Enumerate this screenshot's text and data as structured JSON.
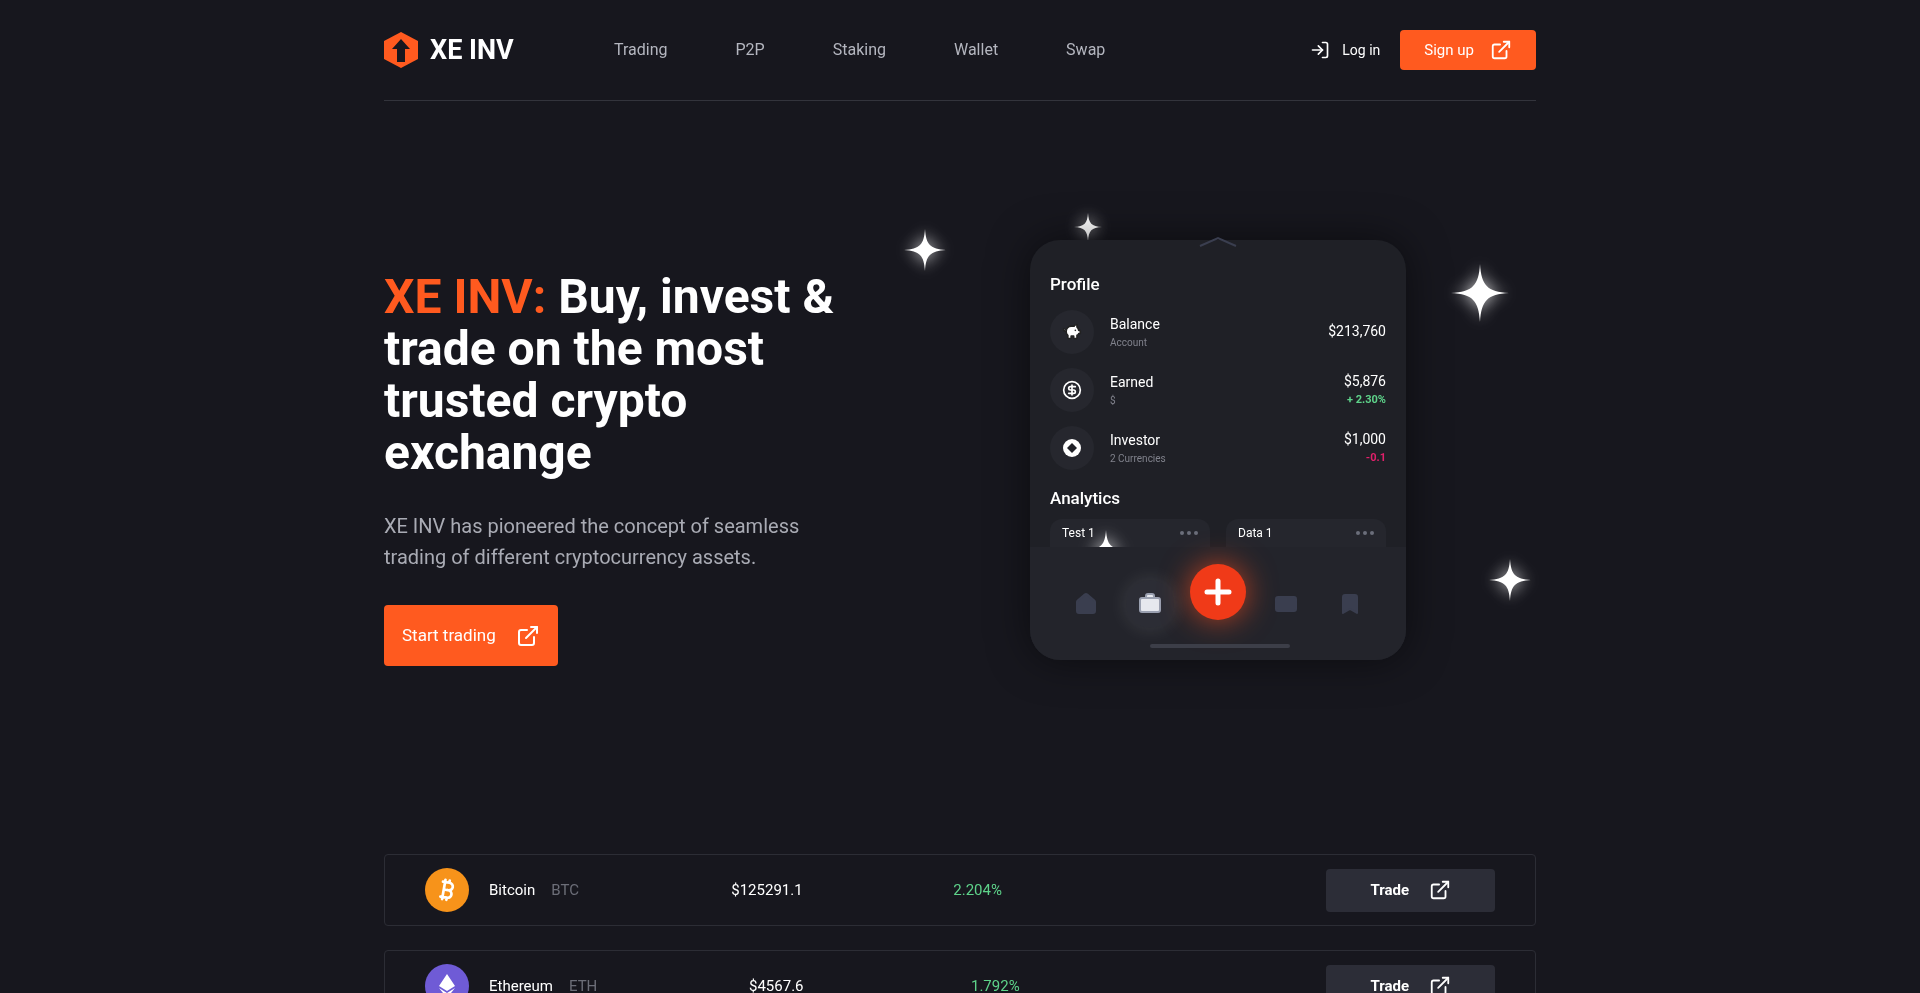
{
  "brand": {
    "name": "XE INV"
  },
  "nav": [
    {
      "label": "Trading"
    },
    {
      "label": "P2P"
    },
    {
      "label": "Staking"
    },
    {
      "label": "Wallet"
    },
    {
      "label": "Swap"
    }
  ],
  "auth": {
    "login": "Log in",
    "signup": "Sign up"
  },
  "hero": {
    "title_accent": "XE INV:",
    "title_rest": "Buy, invest & trade on the most trusted crypto exchange",
    "description": "XE INV has pioneered the concept of seamless trading of different cryptocurrency assets.",
    "cta": "Start trading"
  },
  "phone": {
    "profile_title": "Profile",
    "items": [
      {
        "kind": "piggy",
        "name": "Balance",
        "sub": "Account",
        "value": "$213,760"
      },
      {
        "kind": "moneybag",
        "name": "Earned",
        "sub": "$",
        "value": "$5,876",
        "change": "+ 2.30%",
        "color": "#5ed38a"
      },
      {
        "kind": "coin",
        "name": "Investor",
        "sub": "2 Currencies",
        "value": "$1,000",
        "change": "-0.1",
        "color": "#e0206a"
      }
    ],
    "analytics_title": "Analytics",
    "analytics_cards": [
      {
        "label": "Test 1"
      },
      {
        "label": "Data 1"
      }
    ],
    "tabs": [
      {
        "kind": "home",
        "selected": false
      },
      {
        "kind": "briefcase",
        "selected": true
      },
      {
        "kind": "card",
        "selected": false
      },
      {
        "kind": "bookmark",
        "selected": false
      }
    ]
  },
  "markets": [
    {
      "kind": "btc",
      "name": "Bitcoin",
      "symbol": "BTC",
      "price": "$125291.1",
      "change": "2.204%",
      "action": "Trade"
    },
    {
      "kind": "eth",
      "name": "Ethereum",
      "symbol": "ETH",
      "price": "$4567.6",
      "change": "1.792%",
      "action": "Trade"
    }
  ]
}
